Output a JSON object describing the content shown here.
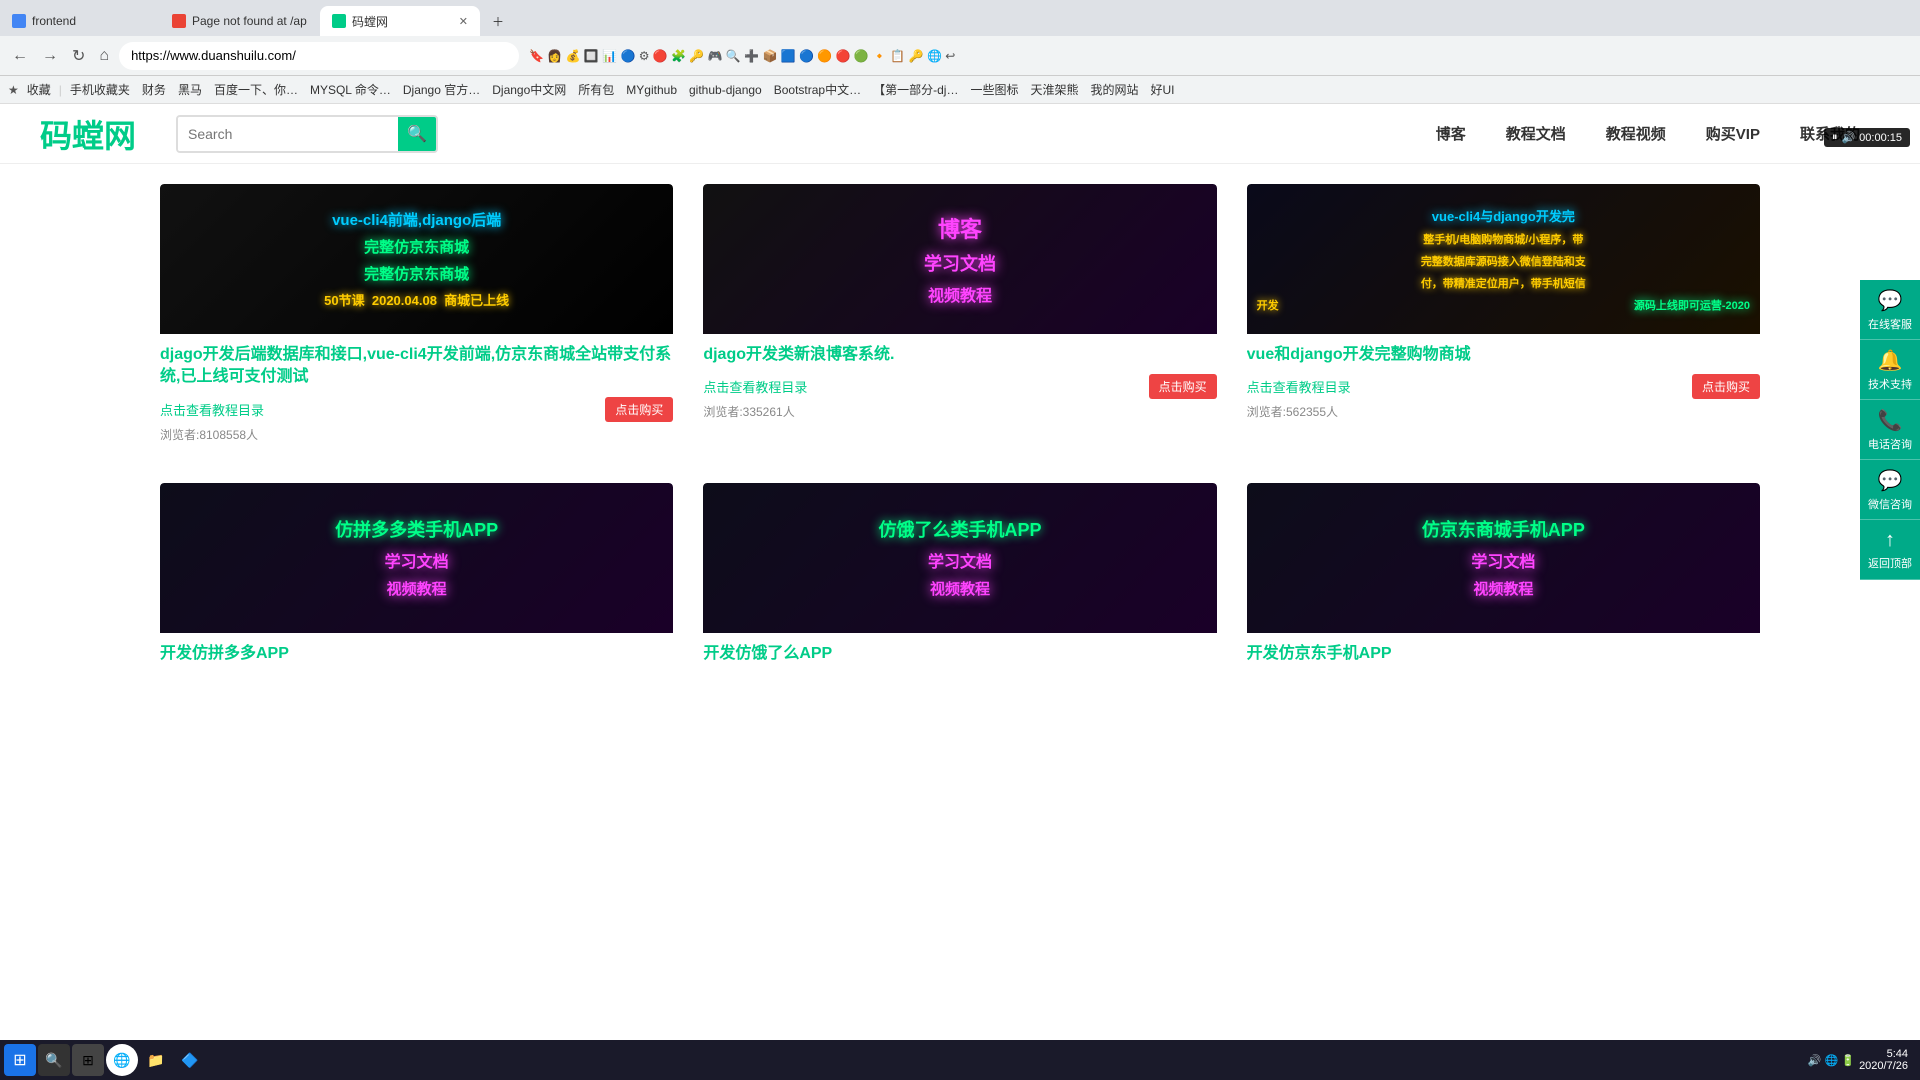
{
  "browser": {
    "tabs": [
      {
        "id": "tab1",
        "title": "frontend",
        "active": false,
        "favicon": "F"
      },
      {
        "id": "tab2",
        "title": "Page not found at /ap",
        "active": false,
        "favicon": "!"
      },
      {
        "id": "tab3",
        "title": "码螳网",
        "active": true,
        "favicon": "M"
      }
    ],
    "address": "https://www.duanshuilu.com/",
    "bookmarks": [
      "收藏",
      "手机收藏夹",
      "财务",
      "黑马",
      "百度一下、你…",
      "MYSQL 命令…",
      "Django 官方…",
      "Django中文网",
      "所有包",
      "MYgithub",
      "github-django",
      "Bootstrap中文…",
      "【第一部分-dj…",
      "一些图标",
      "天淮架熊",
      "我的网站",
      "好UI"
    ]
  },
  "site": {
    "logo": "码螳网",
    "search_placeholder": "Search",
    "nav": [
      "博客",
      "教程文档",
      "教程视频",
      "购买VIP",
      "联系我的"
    ],
    "active_nav": "博客"
  },
  "cards": [
    {
      "id": "card1",
      "image_lines": [
        {
          "text": "vue-cli4前端,django后端",
          "style": "cyan"
        },
        {
          "text": "完整仿京东商城",
          "style": "green-glow"
        },
        {
          "text": "完整仿京东商城",
          "style": "green-glow"
        },
        {
          "text": "50节课   2020.04.08   商城已上线",
          "style": "yellow"
        }
      ],
      "title": "djago开发后端数据库和接口,vue-cli4开发前端,仿京东商城全站带支付系统,已上线可支付测试",
      "link": "点击查看教程目录",
      "views": "浏览者:8108558人",
      "buy_btn": "点击购买"
    },
    {
      "id": "card2",
      "image_lines": [
        {
          "text": "博客",
          "style": "magenta"
        },
        {
          "text": "学习文档",
          "style": "magenta"
        },
        {
          "text": "视频教程",
          "style": "magenta"
        }
      ],
      "title": "djago开发类新浪博客系统.",
      "link": "点击查看教程目录",
      "views": "浏览者:335261人",
      "buy_btn": "点击购买"
    },
    {
      "id": "card3",
      "image_lines": [
        {
          "text": "vue-cli4与django开发完",
          "style": "cyan"
        },
        {
          "text": "整手机/电脑购物商城/小程序，带",
          "style": "yellow"
        },
        {
          "text": "完整数据库源码接入微信登陆和支",
          "style": "yellow"
        },
        {
          "text": "付，带精准定位用户，带手机短信",
          "style": "yellow"
        },
        {
          "text": "开发",
          "style": "yellow"
        },
        {
          "text": "源码上线即可运营-2020",
          "style": "green-glow"
        }
      ],
      "title": "vue和django开发完整购物商城",
      "link": "点击查看教程目录",
      "views": "浏览者:562355人",
      "buy_btn": "点击购买"
    },
    {
      "id": "card4",
      "image_lines": [
        {
          "text": "仿拼多多类手机APP",
          "style": "green-glow"
        },
        {
          "text": "学习文档",
          "style": "magenta"
        },
        {
          "text": "视频教程",
          "style": "magenta"
        }
      ],
      "title": "开发仿拼多多APP",
      "link": "",
      "views": "",
      "buy_btn": ""
    },
    {
      "id": "card5",
      "image_lines": [
        {
          "text": "仿饿了么类手机APP",
          "style": "green-glow"
        },
        {
          "text": "学习文档",
          "style": "magenta"
        },
        {
          "text": "视频教程",
          "style": "magenta"
        }
      ],
      "title": "开发仿饿了么APP",
      "link": "",
      "views": "",
      "buy_btn": ""
    },
    {
      "id": "card6",
      "image_lines": [
        {
          "text": "仿京东商城手机APP",
          "style": "green-glow"
        },
        {
          "text": "学习文档",
          "style": "magenta"
        },
        {
          "text": "视频教程",
          "style": "magenta"
        }
      ],
      "title": "开发仿京东手机APP",
      "link": "",
      "views": "",
      "buy_btn": ""
    }
  ],
  "sidebar_float": [
    {
      "icon": "💬",
      "label": "在线客服"
    },
    {
      "icon": "🔔",
      "label": "技术支持"
    },
    {
      "icon": "📞",
      "label": "电话咨询"
    },
    {
      "icon": "💬",
      "label": "微信咨询"
    },
    {
      "icon": "↑",
      "label": "返回顶部"
    }
  ],
  "mini_player": {
    "time": "00:00:15"
  },
  "taskbar": {
    "time": "5:44",
    "date": "2020/7/26"
  }
}
